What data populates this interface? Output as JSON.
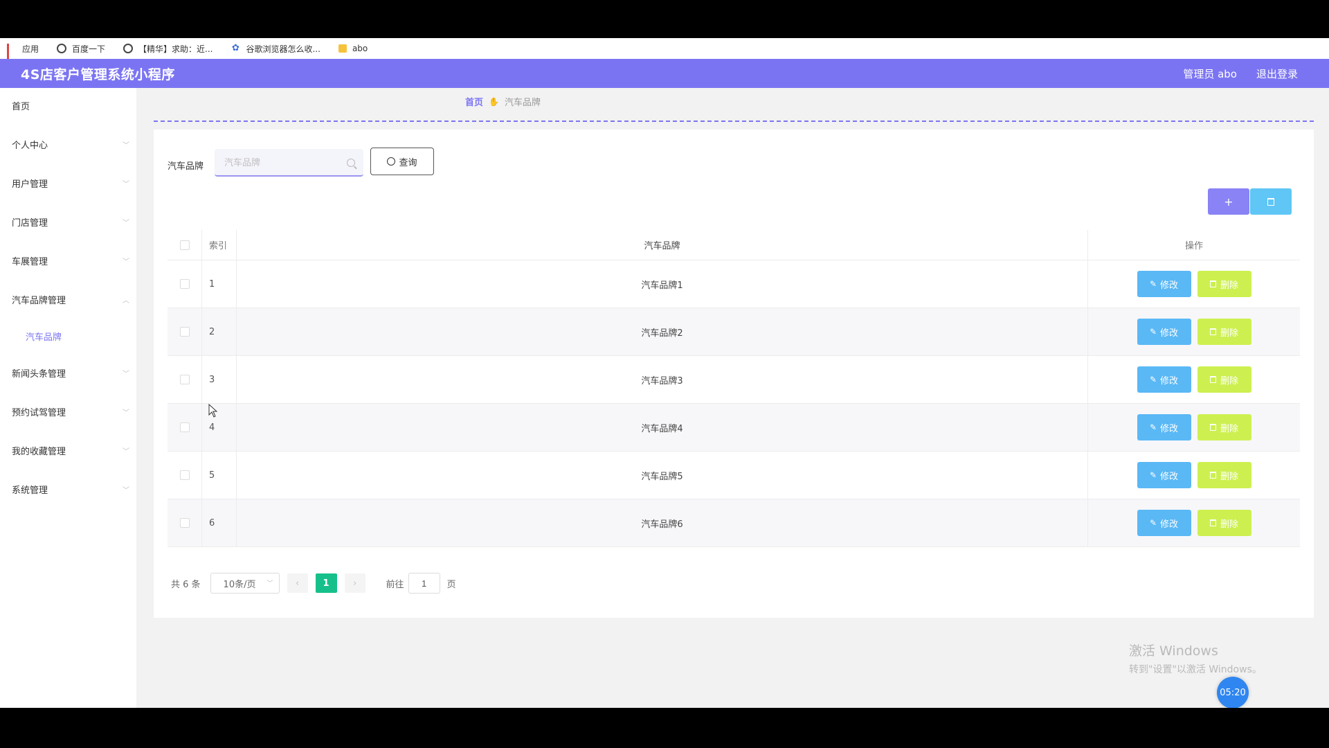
{
  "bookmarks": {
    "items": [
      {
        "label": "应用",
        "icon": "apps-grid-icon"
      },
      {
        "label": "百度一下",
        "icon": "globe-icon"
      },
      {
        "label": "【精华】求助：近...",
        "icon": "globe-icon"
      },
      {
        "label": "谷歌浏览器怎么收...",
        "icon": "paw-icon"
      },
      {
        "label": "abo",
        "icon": "folder-icon"
      }
    ]
  },
  "header": {
    "title": "4S店客户管理系统小程序",
    "user": "管理员 abo",
    "logout": "退出登录",
    "color": "#7b74f2"
  },
  "sidebar": {
    "items": [
      {
        "label": "首页"
      },
      {
        "label": "个人中心"
      },
      {
        "label": "用户管理"
      },
      {
        "label": "门店管理"
      },
      {
        "label": "车展管理"
      },
      {
        "label": "汽车品牌管理"
      },
      {
        "label": "汽车品牌",
        "sub": true
      },
      {
        "label": "新闻头条管理"
      },
      {
        "label": "预约试驾管理"
      },
      {
        "label": "我的收藏管理"
      },
      {
        "label": "系统管理"
      }
    ]
  },
  "breadcrumb": {
    "home": "首页",
    "current": "汽车品牌"
  },
  "search": {
    "label": "汽车品牌",
    "placeholder": "汽车品牌",
    "value": "",
    "button": "查询"
  },
  "toolbar": {
    "add_label": "+",
    "delete_icon": "trash-icon"
  },
  "table": {
    "headers": {
      "index": "索引",
      "brand": "汽车品牌",
      "ops": "操作"
    },
    "edit_label": "修改",
    "delete_label": "删除",
    "rows": [
      {
        "index": "1",
        "brand": "汽车品牌1"
      },
      {
        "index": "2",
        "brand": "汽车品牌2"
      },
      {
        "index": "3",
        "brand": "汽车品牌3"
      },
      {
        "index": "4",
        "brand": "汽车品牌4"
      },
      {
        "index": "5",
        "brand": "汽车品牌5"
      },
      {
        "index": "6",
        "brand": "汽车品牌6"
      }
    ]
  },
  "pager": {
    "total": "共 6 条",
    "page_size": "10条/页",
    "current_page": "1",
    "goto_label": "前往",
    "goto_value": "1",
    "page_unit": "页"
  },
  "system": {
    "watermark_line1": "激活 Windows",
    "watermark_line2": "转到\"设置\"以激活 Windows。",
    "clock": "05:20"
  }
}
